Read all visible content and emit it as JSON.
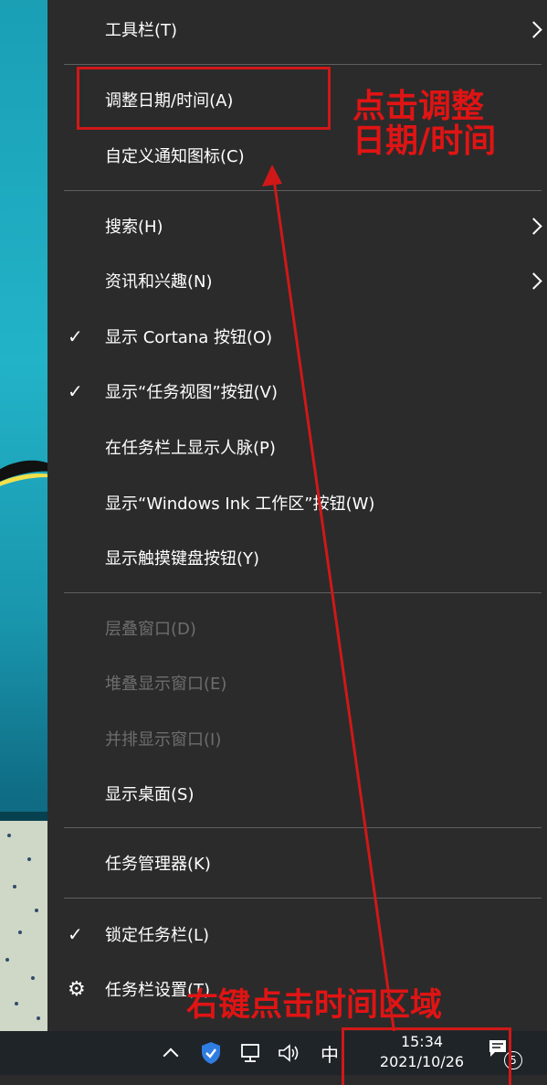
{
  "menu": {
    "toolbars": "工具栏(T)",
    "adjust_datetime": "调整日期/时间(A)",
    "customize_notification_icons": "自定义通知图标(C)",
    "search": "搜索(H)",
    "news_interests": "资讯和兴趣(N)",
    "show_cortana": "显示 Cortana 按钮(O)",
    "show_task_view": "显示“任务视图”按钮(V)",
    "show_people": "在任务栏上显示人脉(P)",
    "show_ink_workspace": "显示“Windows Ink 工作区”按钮(W)",
    "show_touch_keyboard": "显示触摸键盘按钮(Y)",
    "cascade_windows": "层叠窗口(D)",
    "stacked_windows": "堆叠显示窗口(E)",
    "side_by_side_windows": "并排显示窗口(I)",
    "show_desktop": "显示桌面(S)",
    "task_manager": "任务管理器(K)",
    "lock_taskbar": "锁定任务栏(L)",
    "taskbar_settings": "任务栏设置(T)"
  },
  "annotations": {
    "click_adjust_line1": "点击调整",
    "click_adjust_line2": "日期/时间",
    "right_click_time": "右键点击时间区域",
    "color": "#e01414"
  },
  "taskbar": {
    "time": "15:34",
    "date": "2021/10/26",
    "ime": "中",
    "notification_count": "5"
  }
}
